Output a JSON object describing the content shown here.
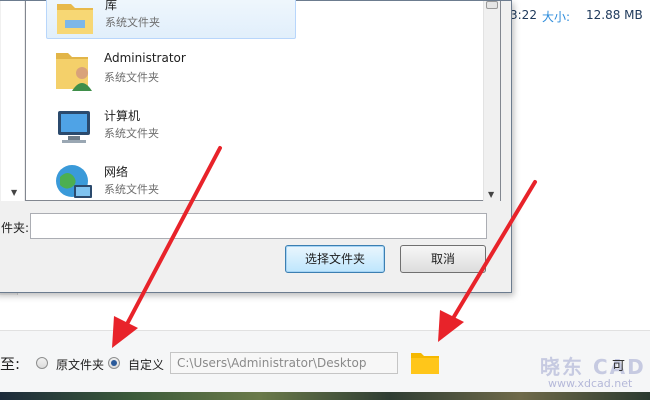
{
  "background_app": {
    "time_fragment": "3:22",
    "size_label": "大小:",
    "size_value": "12.88 MB",
    "right_edge_text": "可"
  },
  "dialog": {
    "items": [
      {
        "name": "库",
        "type": "系统文件夹",
        "icon": "library-folder-icon",
        "selected": true
      },
      {
        "name": "Administrator",
        "type": "系统文件夹",
        "icon": "user-folder-icon",
        "selected": false
      },
      {
        "name": "计算机",
        "type": "系统文件夹",
        "icon": "computer-icon",
        "selected": false
      },
      {
        "name": "网络",
        "type": "系统文件夹",
        "icon": "network-globe-icon",
        "selected": false
      }
    ],
    "folder_label": "件夹:",
    "folder_value": "",
    "select_button": "选择文件夹",
    "cancel_button": "取消"
  },
  "options_bar": {
    "label": "至:",
    "radio_original": "原文件夹",
    "radio_custom": "自定义",
    "selected_option": "自定义",
    "path_value": "C:\\Users\\Administrator\\Desktop",
    "browse_icon": "folder-icon"
  },
  "watermark": {
    "brand": "晓东 CAD",
    "url": "www.xdcad.net"
  },
  "annotation_color": "#e8232a"
}
